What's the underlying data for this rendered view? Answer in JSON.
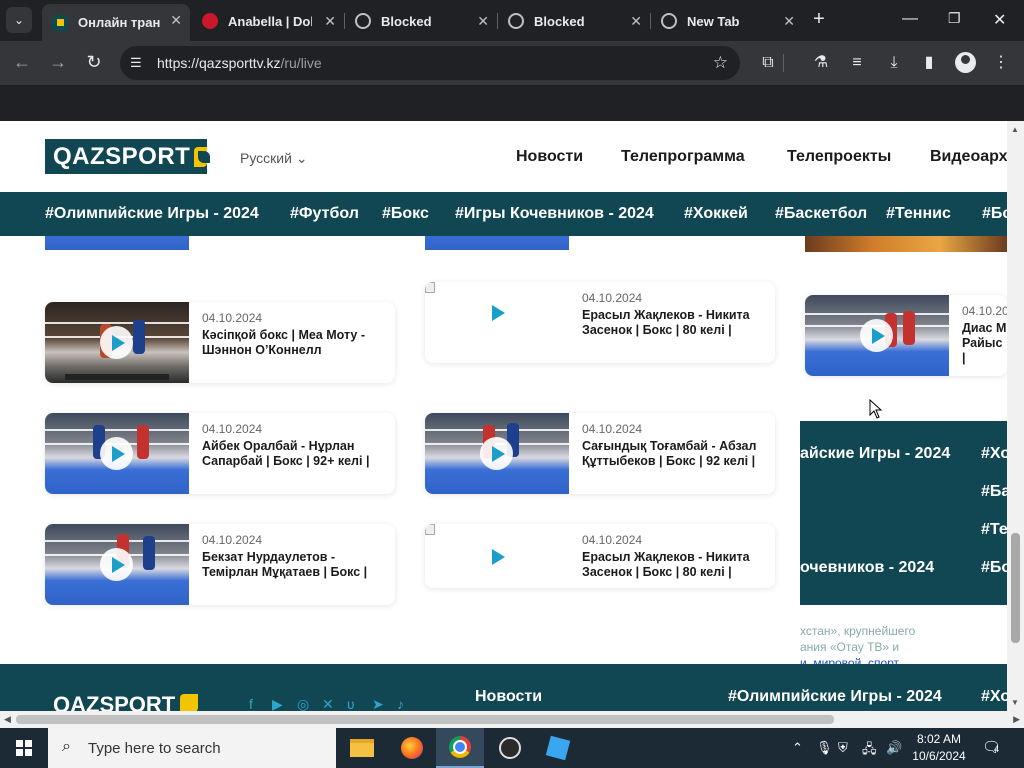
{
  "browser": {
    "tabs": [
      {
        "title": "Онлайн трансл",
        "active": true
      },
      {
        "title": "Anabella | Dok",
        "active": false
      },
      {
        "title": "Blocked",
        "active": false
      },
      {
        "title": "Blocked",
        "active": false
      },
      {
        "title": "New Tab",
        "active": false
      }
    ],
    "url_host": "https://qazsporttv.kz",
    "url_path": "/ru/live"
  },
  "site": {
    "logo_text": "QAZSPORT",
    "language": "Русский",
    "nav": [
      "Новости",
      "Телепрограмма",
      "Телепроекты",
      "Видеоарх"
    ],
    "tags": [
      "#Олимпийские Игры - 2024",
      "#Футбол",
      "#Бокс",
      "#Игры Кочевников - 2024",
      "#Хоккей",
      "#Баскетбол",
      "#Теннис",
      "#Бо"
    ]
  },
  "videos": [
    {
      "date": "04.10.2024",
      "title": "Кәсіпқой бокс | Меа Моту - Шэннон О’Коннелл",
      "thumb": "dark"
    },
    {
      "date": "04.10.2024",
      "title": "Ерасыл Жақлеков - Никита Засенок | Бокс | 80 келі |",
      "thumb": "broken"
    },
    {
      "date": "04.10.20",
      "title": "Диас М Райыс |",
      "thumb": "ring"
    },
    {
      "date": "04.10.2024",
      "title": "Айбек Оралбай - Нұрлан Сапарбай | Бокс | 92+ келі |",
      "thumb": "ring"
    },
    {
      "date": "04.10.2024",
      "title": "Сағындық Тоғамбай - Абзал Құттыбеков | Бокс | 92 келі |",
      "thumb": "ring"
    },
    {
      "date": "04.10.2024",
      "title": "Бекзат Нурдаулетов - Темірлан Мұқатаев | Бокс |",
      "thumb": "ring"
    },
    {
      "date": "04.10.2024",
      "title": "Ерасыл Жақлеков - Никита Засенок | Бокс | 80 келі |",
      "thumb": "broken"
    }
  ],
  "side_band": {
    "tags": [
      "айские Игры - 2024",
      "#Хо",
      "#Ба",
      "#Те",
      "очевников - 2024",
      "#Бо"
    ]
  },
  "footer_blurb": {
    "line1": "хстан», крупнейшего",
    "line2": "ания «Отау ТВ» и",
    "link": "и, мировой, спорт"
  },
  "footer": {
    "logo_text": "QAZSPORT",
    "nav_title": "Новости",
    "tags": [
      "#Олимпийские Игры - 2024",
      "#Хо"
    ]
  },
  "taskbar": {
    "search_placeholder": "Type here to search",
    "time": "8:02 AM",
    "date": "10/6/2024",
    "notifications": "4"
  }
}
